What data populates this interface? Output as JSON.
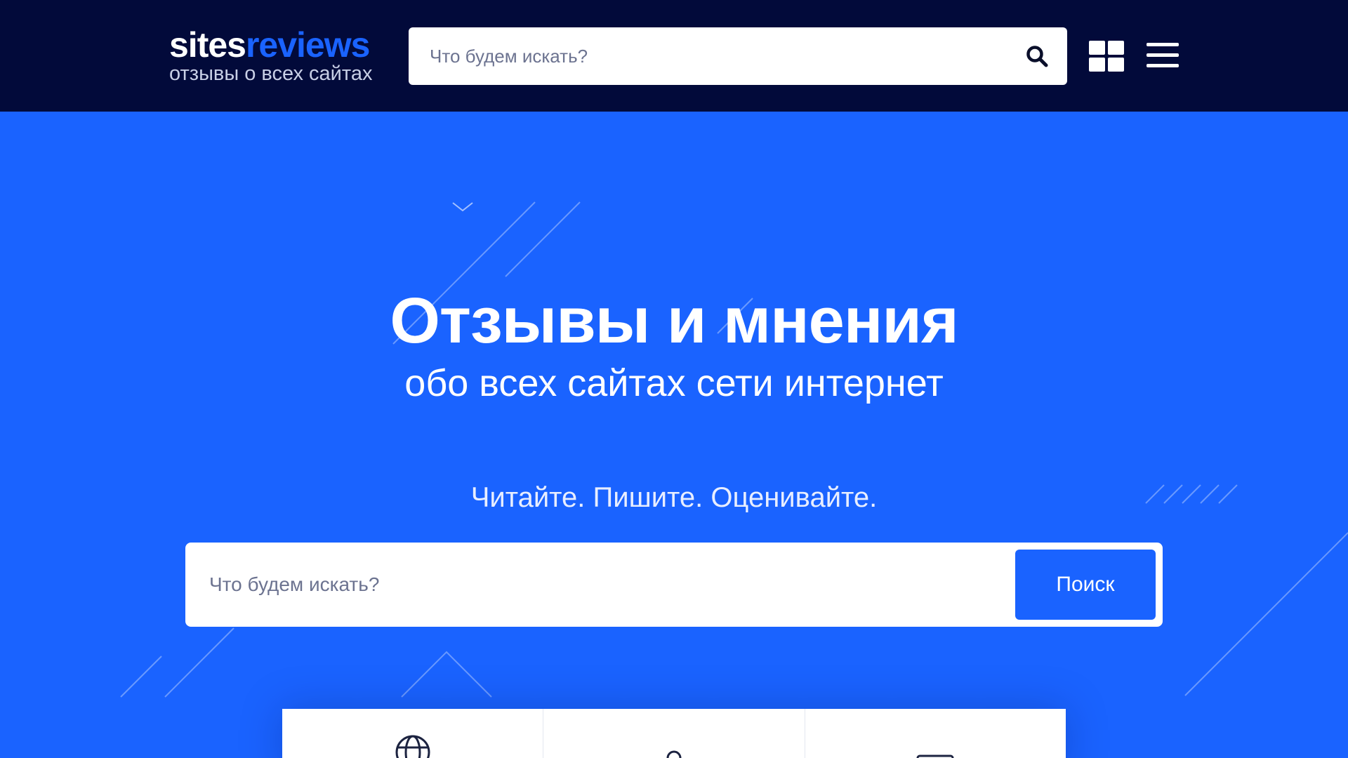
{
  "header": {
    "logo": {
      "part1": "sites",
      "part2": "reviews",
      "tagline": "отзывы о всех сайтах"
    },
    "search": {
      "placeholder": "Что будем искать?",
      "icon": "search-icon"
    },
    "icons": {
      "grid": "grid-icon",
      "menu": "menu-icon"
    }
  },
  "hero": {
    "title": "Отзывы и мнения",
    "subtitle": "обо всех сайтах сети интернет",
    "tagline": "Читайте. Пишите. Оценивайте.",
    "search": {
      "placeholder": "Что будем искать?",
      "button_label": "Поиск"
    }
  },
  "cards": [
    {
      "icon": "globe-icon"
    },
    {
      "icon": "user-icon"
    },
    {
      "icon": "document-icon"
    }
  ],
  "colors": {
    "header_bg": "#020a3a",
    "accent": "#1a63ff",
    "white": "#ffffff"
  }
}
